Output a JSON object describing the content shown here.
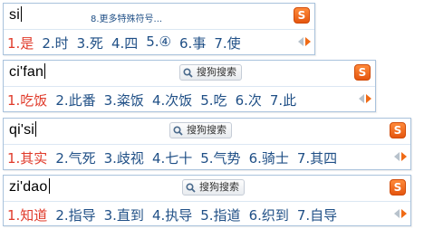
{
  "panels": [
    {
      "pinyin": "si",
      "hint": "8.更多特殊符号...",
      "search_label": "",
      "candidates": [
        "1.是",
        "2.时",
        "3.死",
        "4.四",
        "5.④",
        "6.事",
        "7.使"
      ],
      "logo_letter": "S"
    },
    {
      "pinyin": "ci'fan",
      "hint": "",
      "search_label": "搜狗搜索",
      "candidates": [
        "1.吃饭",
        "2.此番",
        "3.粢饭",
        "4.次饭",
        "5.吃",
        "6.次",
        "7.此"
      ],
      "logo_letter": "S"
    },
    {
      "pinyin": "qi'si",
      "hint": "",
      "search_label": "搜狗搜索",
      "candidates": [
        "1.其实",
        "2.气死",
        "3.歧视",
        "4.七十",
        "5.气势",
        "6.骑士",
        "7.其四"
      ],
      "logo_letter": "S"
    },
    {
      "pinyin": "zi'dao",
      "hint": "",
      "search_label": "搜狗搜索",
      "candidates": [
        "1.知道",
        "2.指导",
        "3.直到",
        "4.执导",
        "5.指道",
        "6.织到",
        "7.自导"
      ],
      "logo_letter": "S"
    }
  ],
  "colors": {
    "first_candidate": "#e03a2a",
    "candidate": "#1f4f86",
    "border": "#a9c2dc",
    "logo": "#ef6a1b"
  }
}
